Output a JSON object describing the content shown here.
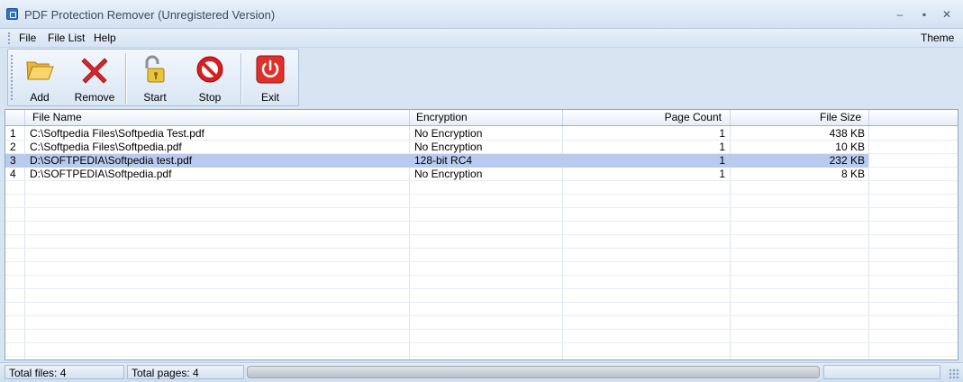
{
  "window": {
    "title": "PDF Protection Remover (Unregistered Version)",
    "controls": {
      "minimize": "‒",
      "maximize": "▪",
      "close": "✕"
    }
  },
  "menu": {
    "items": [
      "File",
      "File List",
      "Help"
    ],
    "theme": "Theme"
  },
  "toolbar": {
    "add_label": "Add",
    "remove_label": "Remove",
    "start_label": "Start",
    "stop_label": "Stop",
    "exit_label": "Exit"
  },
  "table": {
    "columns": [
      "File Name",
      "Encryption",
      "Page Count",
      "File Size"
    ],
    "rows": [
      {
        "index": "1",
        "file": "C:\\Softpedia Files\\Softpedia Test.pdf",
        "encryption": "No Encryption",
        "pages": "1",
        "size": "438 KB"
      },
      {
        "index": "2",
        "file": "C:\\Softpedia Files\\Softpedia.pdf",
        "encryption": "No Encryption",
        "pages": "1",
        "size": "10 KB"
      },
      {
        "index": "3",
        "file": "D:\\SOFTPEDIA\\Softpedia test.pdf",
        "encryption": "128-bit RC4",
        "pages": "1",
        "size": "232 KB"
      },
      {
        "index": "4",
        "file": "D:\\SOFTPEDIA\\Softpedia.pdf",
        "encryption": "No Encryption",
        "pages": "1",
        "size": "8 KB"
      }
    ],
    "selected_row": 3
  },
  "status": {
    "total_files": "Total files: 4",
    "total_pages": "Total pages: 4"
  },
  "colors": {
    "selection": "#b8cbef",
    "chrome": "#d7e4f2",
    "exit_red": "#e0302a",
    "stop_red": "#d81e1e",
    "remove_red": "#d7262b"
  },
  "icons": {
    "add": "folder-open-icon",
    "remove": "red-x-icon",
    "start": "unlock-icon",
    "stop": "no-entry-icon",
    "exit": "power-icon"
  }
}
